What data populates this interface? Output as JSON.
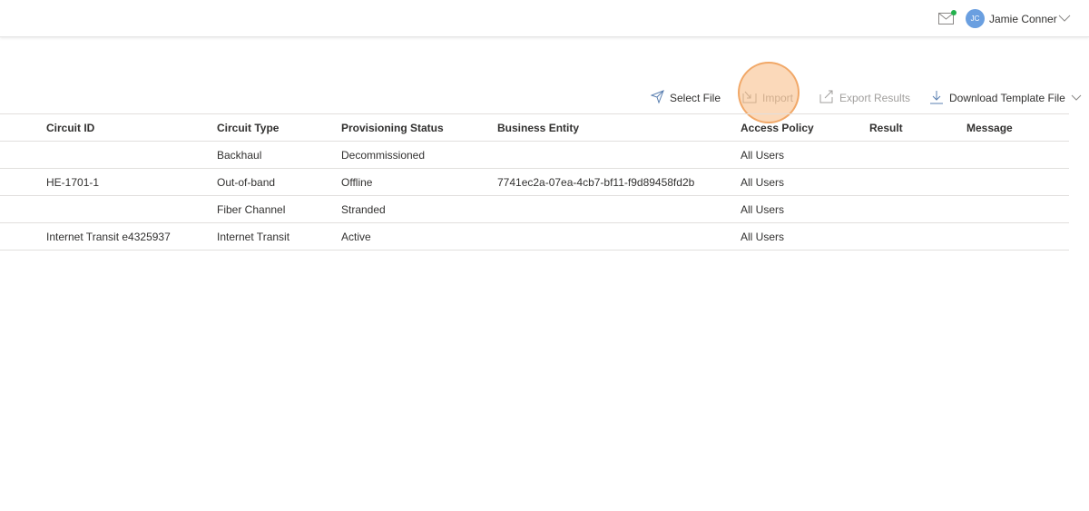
{
  "header": {
    "user_initials": "JC",
    "user_name": "Jamie Conner"
  },
  "toolbar": {
    "select_file": "Select File",
    "import": "Import",
    "export_results": "Export Results",
    "download_template": "Download Template File"
  },
  "table": {
    "columns": [
      "Circuit ID",
      "Circuit Type",
      "Provisioning Status",
      "Business Entity",
      "Access Policy",
      "Result",
      "Message"
    ],
    "rows": [
      [
        "",
        "Backhaul",
        "Decommissioned",
        "",
        "All Users",
        "",
        ""
      ],
      [
        "HE-1701-1",
        "Out-of-band",
        "Offline",
        "7741ec2a-07ea-4cb7-bf11-f9d89458fd2b",
        "All Users",
        "",
        ""
      ],
      [
        "",
        "Fiber Channel",
        "Stranded",
        "",
        "All Users",
        "",
        ""
      ],
      [
        "Internet Transit e4325937",
        "Internet Transit",
        "Active",
        "",
        "All Users",
        "",
        ""
      ]
    ]
  },
  "colors": {
    "avatar": "#6a9fe0",
    "notification_dot": "#22b14c",
    "click_highlight": "#f7ba82",
    "disabled_text": "#a19f9d"
  },
  "icons": {
    "mail": "mail-icon",
    "select_file": "send-icon",
    "import": "import-icon",
    "export": "export-icon",
    "download": "download-icon"
  }
}
